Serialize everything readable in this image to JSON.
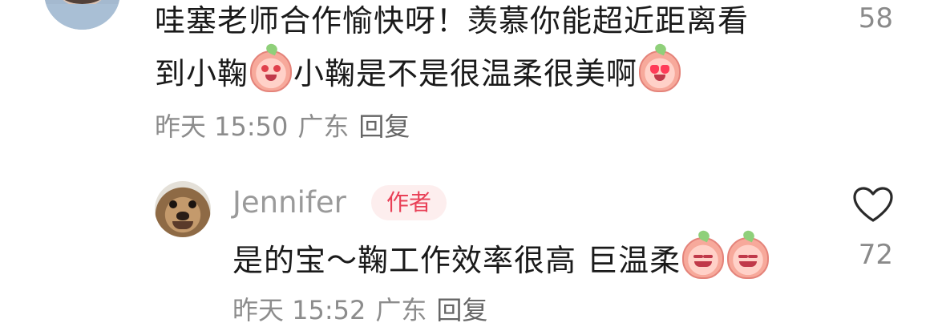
{
  "parent_comment": {
    "avatar_icon": "user-avatar-woman",
    "line1": "哇塞老师合作愉快呀！羡慕你能超近距离看",
    "line2_part1": "到小鞠",
    "line2_part2": "小鞠是不是很温柔很美啊",
    "time": "昨天 15:50",
    "location": "广东",
    "reply_label": "回复",
    "likes": "58"
  },
  "reply_comment": {
    "avatar_icon": "dog-avatar",
    "username": "Jennifer",
    "author_badge": "作者",
    "text": "是的宝～鞠工作效率很高 巨温柔",
    "time": "昨天 15:52",
    "location": "广东",
    "reply_label": "回复",
    "likes": "72",
    "like_icon": "heart-outline-icon"
  },
  "colors": {
    "text": "#1a1a1a",
    "meta": "#8c8c8c",
    "badge_text": "#e94057",
    "badge_bg": "#fdeeee"
  }
}
